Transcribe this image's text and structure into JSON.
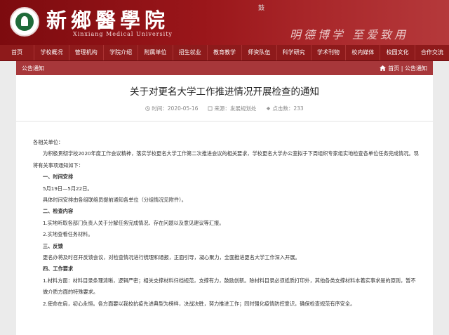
{
  "header": {
    "cn_title": "新鄉醫學院",
    "en_title": "Xinxiang Medical University",
    "motto": "明德博学 至爱致用",
    "top_mark": "鼓"
  },
  "nav": [
    "首页",
    "学校概况",
    "管理机构",
    "学院介绍",
    "附属单位",
    "招生就业",
    "教育教学",
    "师资队伍",
    "科学研究",
    "学术刊物",
    "校内媒体",
    "校园文化",
    "合作交流"
  ],
  "pagebar": {
    "section": "公告通知",
    "breadcrumb": "首页 | 公告通知"
  },
  "article": {
    "title": "关于对更名大学工作推进情况开展检查的通知",
    "date": "时间：2020-05-16",
    "source": "来源：发展规划处",
    "views": "点击数：233",
    "paragraphs": [
      "各相关单位：",
      "为积极贯彻学校2020年度工作会议精神，落实学校更名大学工作第二次推进会议的相关要求，学校更名大学办公室拟于下周组织专家组实地检查各单位任务完成情况。现将有关事项通知如下：",
      "一、时间安排",
      "5月19日—5月22日。",
      "具体时间安排由各组联络员提前通知各单位（分组情况见附件）。",
      "二、检查内容",
      "1.实地听取各部门负责人关于分解任务完成情况、存在问题以及意见建议等汇报。",
      "2.实地查看任务材料。",
      "三、反馈",
      "更名办将及时召开反馈会议，对检查情况进行梳理和通报，正面引导，凝心聚力，全面推进更名大学工作深入开展。",
      "四、工作要求",
      "1.材料方面：材料目录条理清晰，逻辑严密；相关支撑材料归档规范，支撑有力，鼓励创新。除材料目录必须纸质打印外，其他各类支撑材料本着实事求是的原则，暂不做介质方面的特殊要求。",
      "2.使命在肩，初心永恒。各方面要以我校抗疫先进典型为榜样，决战决胜，努力推进工作；同时强化疫情防控意识，确保检查规范有序安全。"
    ]
  }
}
